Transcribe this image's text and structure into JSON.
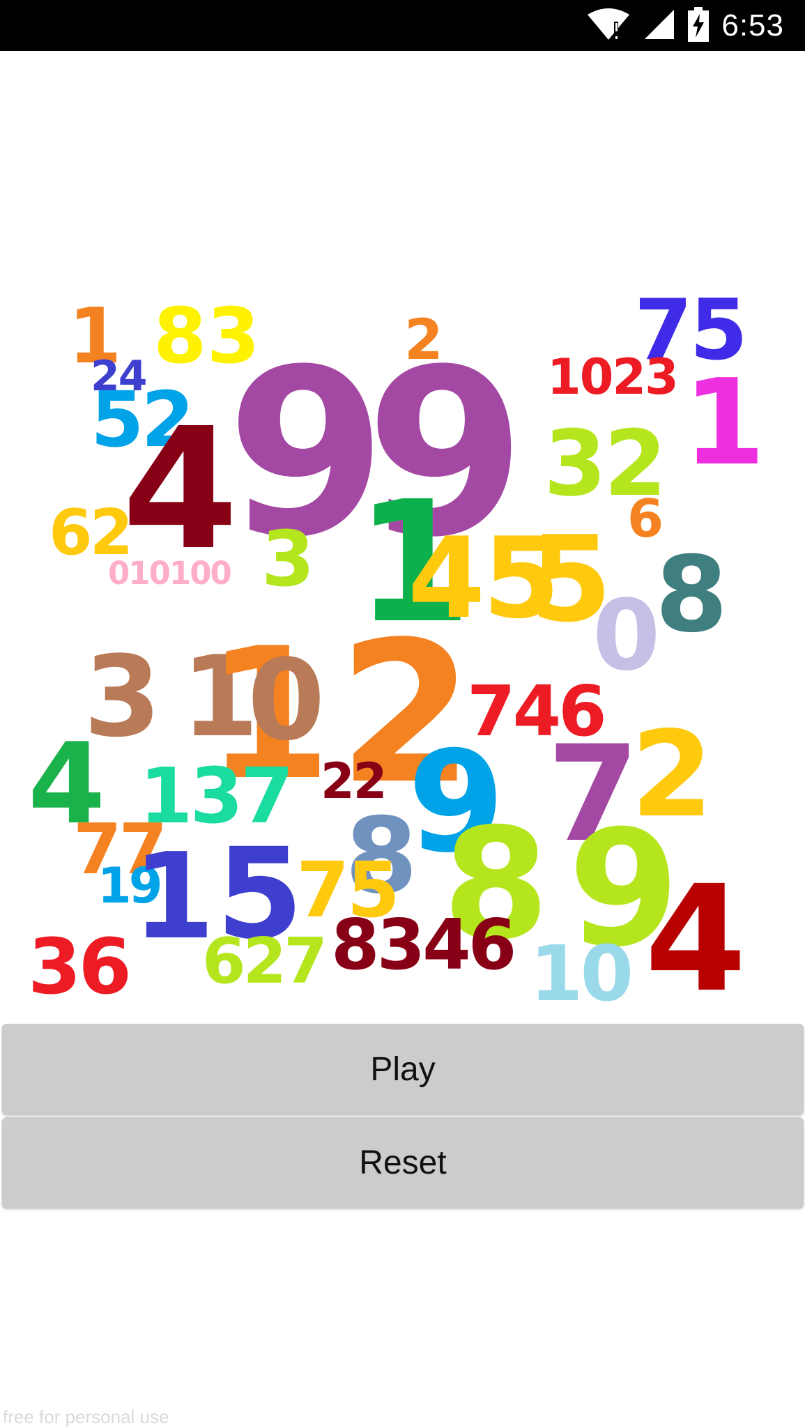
{
  "status_bar": {
    "time": "6:53",
    "icons": [
      "wifi-alert-icon",
      "cell-signal-icon",
      "battery-charging-icon"
    ]
  },
  "numbers_image": {
    "description_icon": "colorful-numbers-image",
    "numbers": [
      {
        "text": "1",
        "color": "#F58220"
      },
      {
        "text": "83",
        "color": "#FFF200"
      },
      {
        "text": "2",
        "color": "#F58220"
      },
      {
        "text": "75",
        "color": "#3F2BE8"
      },
      {
        "text": "24",
        "color": "#3F3FCF"
      },
      {
        "text": "52",
        "color": "#00A2E8"
      },
      {
        "text": "4",
        "color": "#880015"
      },
      {
        "text": "99",
        "color": "#A349A4"
      },
      {
        "text": "1023",
        "color": "#ED1C24"
      },
      {
        "text": "1",
        "color": "#EE2FE0"
      },
      {
        "text": "32",
        "color": "#B5E61D"
      },
      {
        "text": "6",
        "color": "#F58220"
      },
      {
        "text": "62",
        "color": "#FFC90E"
      },
      {
        "text": "010100",
        "color": "#FFAEC9"
      },
      {
        "text": "3",
        "color": "#B5E61D"
      },
      {
        "text": "1",
        "color": "#0DB14B"
      },
      {
        "text": "45",
        "color": "#FFC90E"
      },
      {
        "text": "5",
        "color": "#FFC90E"
      },
      {
        "text": "8",
        "color": "#3F7F7F"
      },
      {
        "text": "0",
        "color": "#C8BFE7"
      },
      {
        "text": "3",
        "color": "#B97A57"
      },
      {
        "text": "1",
        "color": "#B97A57"
      },
      {
        "text": "1",
        "color": "#F58220"
      },
      {
        "text": "0",
        "color": "#B97A57"
      },
      {
        "text": "2",
        "color": "#F58220"
      },
      {
        "text": "746",
        "color": "#ED1C24"
      },
      {
        "text": "4",
        "color": "#1AB24A"
      },
      {
        "text": "137",
        "color": "#1ADBA0"
      },
      {
        "text": "22",
        "color": "#880015"
      },
      {
        "text": "9",
        "color": "#00A2E8"
      },
      {
        "text": "7",
        "color": "#A349A4"
      },
      {
        "text": "2",
        "color": "#FFC90E"
      },
      {
        "text": "77",
        "color": "#F58220"
      },
      {
        "text": "8",
        "color": "#7092BE"
      },
      {
        "text": "19",
        "color": "#00A2E8"
      },
      {
        "text": "1",
        "color": "#3F3FCF"
      },
      {
        "text": "5",
        "color": "#3F3FCF"
      },
      {
        "text": "75",
        "color": "#FFC90E"
      },
      {
        "text": "8",
        "color": "#B5E61D"
      },
      {
        "text": "9",
        "color": "#B5E61D"
      },
      {
        "text": "36",
        "color": "#ED1C24"
      },
      {
        "text": "627",
        "color": "#B5E61D"
      },
      {
        "text": "8346",
        "color": "#880015"
      },
      {
        "text": "10",
        "color": "#99D9EA"
      },
      {
        "text": "4",
        "color": "#B80000"
      }
    ]
  },
  "buttons": {
    "play_label": "Play",
    "reset_label": "Reset"
  },
  "watermark": "free for personal use"
}
